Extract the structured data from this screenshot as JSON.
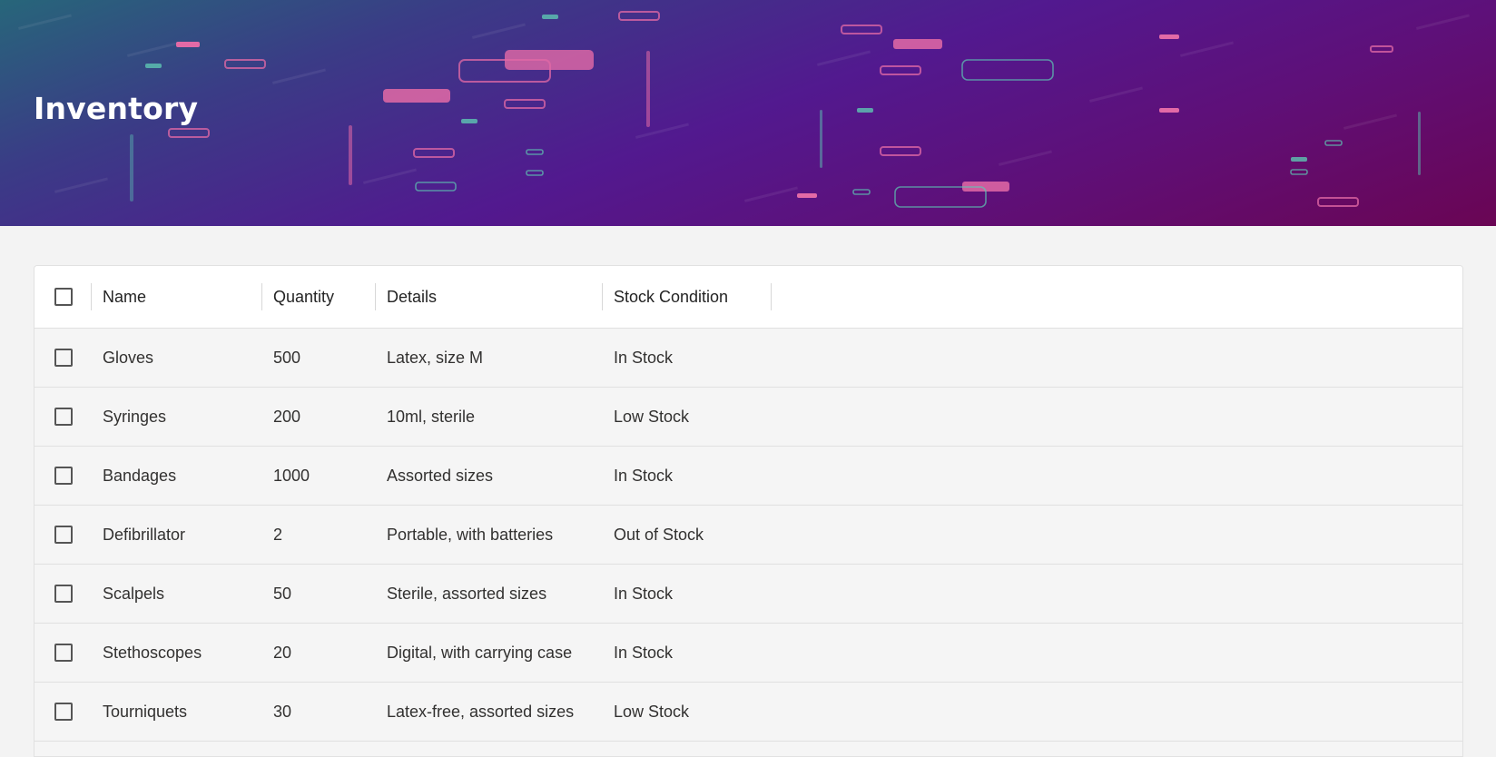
{
  "page": {
    "title": "Inventory"
  },
  "colors": {
    "banner_gradient": [
      "#27667a",
      "#52198f",
      "#6a0554"
    ],
    "accent_pink": "#e36aa6",
    "accent_teal": "#5ec6b3"
  },
  "grid": {
    "columns": [
      {
        "key": "name",
        "label": "Name"
      },
      {
        "key": "quantity",
        "label": "Quantity"
      },
      {
        "key": "details",
        "label": "Details"
      },
      {
        "key": "stock",
        "label": "Stock Condition"
      }
    ],
    "select_all_icon": "checkbox-icon",
    "rows": [
      {
        "name": "Gloves",
        "quantity": "500",
        "details": "Latex, size M",
        "stock": "In Stock"
      },
      {
        "name": "Syringes",
        "quantity": "200",
        "details": "10ml, sterile",
        "stock": "Low Stock"
      },
      {
        "name": "Bandages",
        "quantity": "1000",
        "details": "Assorted sizes",
        "stock": "In Stock"
      },
      {
        "name": "Defibrillator",
        "quantity": "2",
        "details": "Portable, with batteries",
        "stock": "Out of Stock"
      },
      {
        "name": "Scalpels",
        "quantity": "50",
        "details": "Sterile, assorted sizes",
        "stock": "In Stock"
      },
      {
        "name": "Stethoscopes",
        "quantity": "20",
        "details": "Digital, with carrying case",
        "stock": "In Stock"
      },
      {
        "name": "Tourniquets",
        "quantity": "30",
        "details": "Latex-free, assorted sizes",
        "stock": "Low Stock"
      }
    ]
  }
}
